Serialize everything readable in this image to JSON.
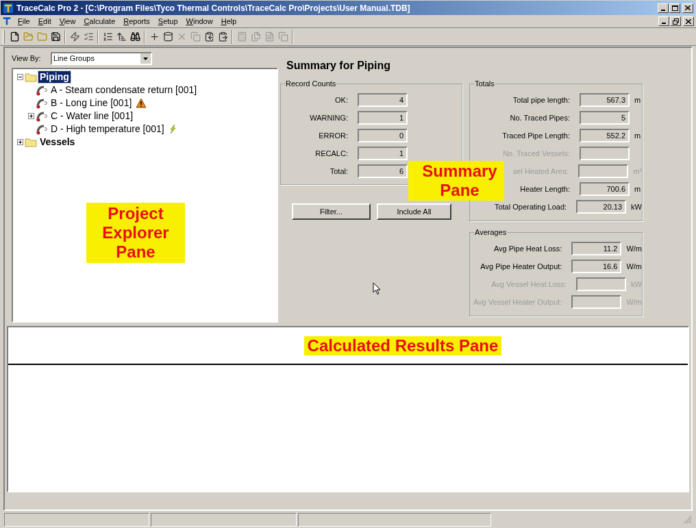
{
  "window": {
    "title": "TraceCalc Pro 2 - [C:\\Program Files\\Tyco Thermal Controls\\TraceCalc Pro\\Projects\\User Manual.TDB]"
  },
  "menu": [
    {
      "label": "File"
    },
    {
      "label": "Edit"
    },
    {
      "label": "View"
    },
    {
      "label": "Calculate"
    },
    {
      "label": "Reports"
    },
    {
      "label": "Setup"
    },
    {
      "label": "Window"
    },
    {
      "label": "Help"
    }
  ],
  "explorer": {
    "view_by_label": "View By:",
    "view_by_value": "Line Groups",
    "tree": [
      {
        "label": "Piping",
        "kind": "folder",
        "expanded": true,
        "selected": true,
        "children": [
          {
            "label": "A - Steam condensate return [001]",
            "kind": "line",
            "selected": false,
            "warning": false,
            "recalc": false
          },
          {
            "label": "B - Long Line [001]",
            "kind": "line",
            "selected": false,
            "warning": true,
            "recalc": false
          },
          {
            "label": "C - Water line [001]",
            "kind": "line",
            "selected": false,
            "expanded": false,
            "warning": false,
            "recalc": false
          },
          {
            "label": "D - High temperature [001]",
            "kind": "line",
            "selected": false,
            "warning": false,
            "recalc": true
          }
        ]
      },
      {
        "label": "Vessels",
        "kind": "folder",
        "expanded": false,
        "selected": false
      }
    ]
  },
  "summary": {
    "title": "Summary for Piping",
    "record_counts": {
      "title": "Record Counts",
      "rows": [
        {
          "label": "OK:",
          "value": "4"
        },
        {
          "label": "WARNING:",
          "value": "1"
        },
        {
          "label": "ERROR:",
          "value": "0"
        },
        {
          "label": "RECALC:",
          "value": "1"
        },
        {
          "label": "Total:",
          "value": "6"
        }
      ]
    },
    "buttons": [
      "Filter...",
      "Include All"
    ],
    "totals": {
      "title": "Totals",
      "rows": [
        {
          "label": "Total pipe length:",
          "value": "567.3",
          "unit": "m",
          "disabled": false
        },
        {
          "label": "No. Traced Pipes:",
          "value": "5",
          "disabled": false
        },
        {
          "label": "Traced Pipe Length:",
          "value": "552.2",
          "unit": "m",
          "disabled": false
        },
        {
          "label": "No. Traced Vessels:",
          "disabled": true
        },
        {
          "label": "sel Heated Area:",
          "unit": "m²",
          "disabled": true
        },
        {
          "label": "Heater Length:",
          "value": "700.6",
          "unit": "m",
          "disabled": false
        },
        {
          "label": "Total Operating Load:",
          "value": "20.13",
          "unit": "kW",
          "disabled": false
        }
      ]
    },
    "averages": {
      "title": "Averages",
      "rows": [
        {
          "label": "Avg Pipe Heat Loss:",
          "value": "11.2",
          "unit": "W/m",
          "disabled": false
        },
        {
          "label": "Avg Pipe Heater Output:",
          "value": "16.6",
          "unit": "W/m",
          "disabled": false
        },
        {
          "label": "Avg Vessel Heat Loss:",
          "unit": "kW",
          "disabled": true
        },
        {
          "label": "Avg Vessel Heater Output:",
          "unit": "W/m",
          "disabled": true
        }
      ]
    }
  },
  "annotations": [
    {
      "text": "Project Explorer Pane"
    },
    {
      "text": "Summary Pane"
    },
    {
      "text": "Calculated Results Pane"
    }
  ]
}
